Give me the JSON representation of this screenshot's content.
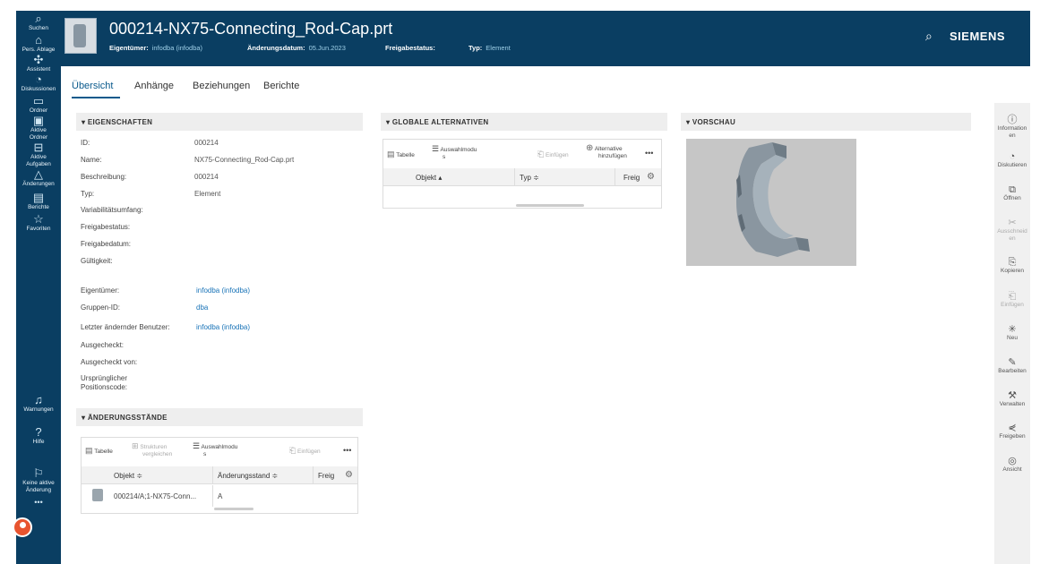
{
  "nav": {
    "items": [
      {
        "icon": "search-icon",
        "glyph": "⌕",
        "label": "Suchen"
      },
      {
        "icon": "home-icon",
        "glyph": "⌂",
        "label": "Pers. Ablage"
      },
      {
        "icon": "assistant-icon",
        "glyph": "✣",
        "label": "Assistent"
      },
      {
        "icon": "discussion-icon",
        "glyph": "◔",
        "label": "Diskussionen"
      },
      {
        "icon": "folder-icon",
        "glyph": "▭",
        "label": "Ordner"
      },
      {
        "icon": "active-folder-icon",
        "glyph": "▣",
        "label": "Aktive Ordner"
      },
      {
        "icon": "inbox-icon",
        "glyph": "⊟",
        "label": "Aktive Aufgaben"
      },
      {
        "icon": "changes-icon",
        "glyph": "△",
        "label": "Änderungen"
      },
      {
        "icon": "reports-icon",
        "glyph": "▤",
        "label": "Berichte"
      },
      {
        "icon": "star-icon",
        "glyph": "☆",
        "label": "Favoriten"
      },
      {
        "icon": "bell-icon",
        "glyph": "♫",
        "label": "Warnungen"
      },
      {
        "icon": "help-icon",
        "glyph": "?",
        "label": "Hilfe"
      },
      {
        "icon": "no-change-icon",
        "glyph": "⚐",
        "label": "Keine aktive Änderung"
      },
      {
        "icon": "more-icon",
        "glyph": "•••",
        "label": ""
      }
    ]
  },
  "header": {
    "title": "000214-NX75-Connecting_Rod-Cap.prt",
    "owner_label": "Eigentümer:",
    "owner_value": "infodba (infodba)",
    "date_label": "Änderungsdatum:",
    "date_value": "05.Jun.2023",
    "release_label": "Freigabestatus:",
    "type_label": "Typ:",
    "type_value": "Element",
    "brand": "SIEMENS"
  },
  "tabs": [
    "Übersicht",
    "Anhänge",
    "Beziehungen",
    "Berichte"
  ],
  "properties": {
    "heading": "▾ EIGENSCHAFTEN",
    "rows": [
      {
        "label": "ID:",
        "value": ""
      },
      {
        "label": "Name:",
        "value": ""
      },
      {
        "label": "Beschreibung:",
        "value": ""
      },
      {
        "label": "Typ:",
        "value": ""
      },
      {
        "label": "Variabilitätsumfang:",
        "value": ""
      },
      {
        "label": "Freigabestatus:",
        "value": ""
      },
      {
        "label": "Freigabedatum:",
        "value": ""
      },
      {
        "label": "Gültigkeit:",
        "value": ""
      },
      {
        "label": "Eigentümer:",
        "value": ""
      },
      {
        "label": "Gruppen-ID:",
        "value": ""
      },
      {
        "label": "Letzter ändernder Benutzer:",
        "value": ""
      },
      {
        "label": "Ausgecheckt:",
        "value": ""
      },
      {
        "label": "Ausgecheckt von:",
        "value": ""
      },
      {
        "label": "Ursprünglicher",
        "value": ""
      },
      {
        "label": "Positionscode:",
        "value": ""
      }
    ],
    "values": {
      "id": "000214",
      "name": "NX75-Connecting_Rod-Cap.prt",
      "description": "000214",
      "type": "Element",
      "owner": "infodba (infodba)",
      "group": "dba",
      "last_user": "infodba (infodba)"
    }
  },
  "revisions": {
    "heading": "▾ ÄNDERUNGSSTÄNDE",
    "tool_table": "Tabelle",
    "tool_compare_1": "Strukturen",
    "tool_compare_2": "vergleichen",
    "tool_select_1": "Auswahlmodu",
    "tool_select_2": "s",
    "tool_paste": "Einfügen",
    "more": "•••",
    "col_object": "Objekt ≑",
    "col_rev": "Änderungsstand ≑",
    "col_rel": "Freig",
    "row_object": "000214/A;1-NX75-Conn...",
    "row_rev": "A"
  },
  "alternatives": {
    "heading": "▾ GLOBALE ALTERNATIVEN",
    "tool_table": "Tabelle",
    "tool_select_1": "Auswahlmodu",
    "tool_select_2": "s",
    "tool_paste": "Einfügen",
    "tool_add_1": "Alternative",
    "tool_add_2": "hinzufügen",
    "more": "•••",
    "col_object": "Objekt ▴",
    "col_type": "Typ ≑",
    "col_rel": "Freig"
  },
  "preview": {
    "heading": "▾ VORSCHAU"
  },
  "right_actions": [
    {
      "icon": "info-icon",
      "glyph": "ⓘ",
      "label1": "Information",
      "label2": "en",
      "disabled": false
    },
    {
      "icon": "discuss-icon",
      "glyph": "◔",
      "label1": "Diskutieren",
      "label2": "",
      "disabled": false
    },
    {
      "icon": "open-icon",
      "glyph": "⧉",
      "label1": "Öffnen",
      "label2": "",
      "disabled": false
    },
    {
      "icon": "cut-icon",
      "glyph": "✂",
      "label1": "Ausschneid",
      "label2": "en",
      "disabled": true
    },
    {
      "icon": "copy-icon",
      "glyph": "⎘",
      "label1": "Kopieren",
      "label2": "",
      "disabled": false
    },
    {
      "icon": "paste-icon",
      "glyph": "⎗",
      "label1": "Einfügen",
      "label2": "",
      "disabled": true
    },
    {
      "icon": "new-icon",
      "glyph": "✳",
      "label1": "Neu",
      "label2": "",
      "disabled": false
    },
    {
      "icon": "edit-icon",
      "glyph": "✎",
      "label1": "Bearbeiten",
      "label2": "",
      "disabled": false
    },
    {
      "icon": "manage-icon",
      "glyph": "⚒",
      "label1": "Verwalten",
      "label2": "",
      "disabled": false
    },
    {
      "icon": "share-icon",
      "glyph": "⋞",
      "label1": "Freigeben",
      "label2": "",
      "disabled": false
    },
    {
      "icon": "view-icon",
      "glyph": "◎",
      "label1": "Ansicht",
      "label2": "",
      "disabled": false
    }
  ],
  "colors": {
    "nav_bg": "#0a3e62",
    "accent": "#0a5a8c",
    "link": "#1a74b8"
  }
}
